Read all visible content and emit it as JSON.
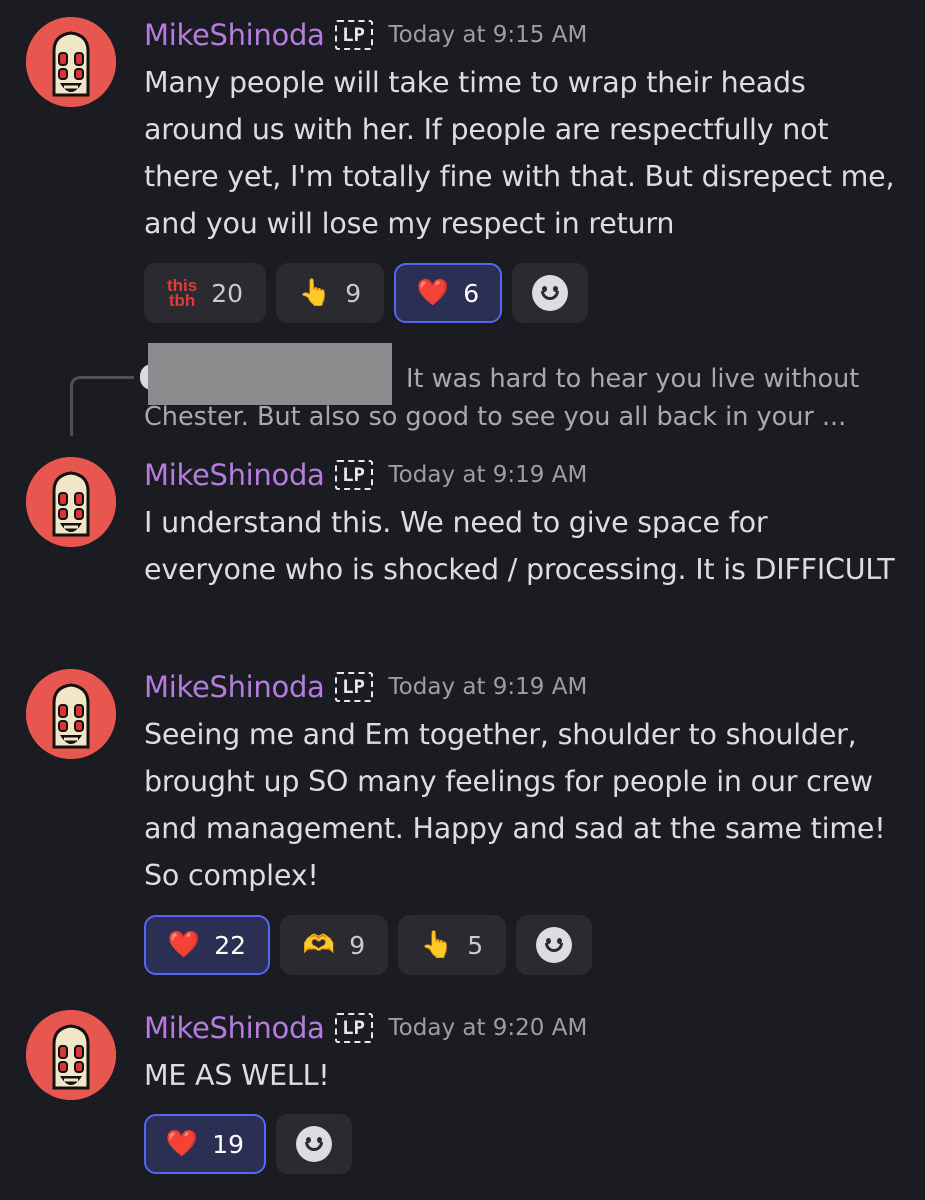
{
  "messages": [
    {
      "username": "MikeShinoda",
      "tag": "LP",
      "timestamp": "Today at 9:15 AM",
      "text": "Many people will take time to wrap their heads around us with her. If people are respectfully not there yet, I'm totally fine with that. But disrepect me, and you will lose my respect in return",
      "reactions": [
        {
          "emoji": "this tbh",
          "count": "20",
          "active": false
        },
        {
          "emoji": "👆",
          "count": "9",
          "active": false
        },
        {
          "emoji": "❤️",
          "count": "6",
          "active": true
        }
      ]
    },
    {
      "reply_to": "It was hard to hear you live without Chester. But also so good to see you all back in your ...",
      "username": "MikeShinoda",
      "tag": "LP",
      "timestamp": "Today at 9:19 AM",
      "text": "I understand this. We need to give space for everyone who is shocked / processing. It is DIFFICULT"
    },
    {
      "username": "MikeShinoda",
      "tag": "LP",
      "timestamp": "Today at 9:19 AM",
      "text": "Seeing me and Em together, shoulder to shoulder, brought up SO many feelings for people in our crew and management. Happy and sad at the same time! So complex!",
      "reactions": [
        {
          "emoji": "❤️",
          "count": "22",
          "active": true
        },
        {
          "emoji": "🫶",
          "count": "9",
          "active": false
        },
        {
          "emoji": "👆",
          "count": "5",
          "active": false
        }
      ]
    },
    {
      "username": "MikeShinoda",
      "tag": "LP",
      "timestamp": "Today at 9:20 AM",
      "text": "ME AS WELL!",
      "reactions": [
        {
          "emoji": "❤️",
          "count": "19",
          "active": true
        }
      ]
    }
  ],
  "colors": {
    "background": "#1b1c21",
    "username": "#b57ce0",
    "active_reaction_border": "#5865f2",
    "avatar": "#e8574f"
  },
  "icons": {
    "add_reaction": "smiley-face-icon",
    "avatar": "skull-avatar-icon",
    "server_tag": "lp-tag-icon"
  }
}
